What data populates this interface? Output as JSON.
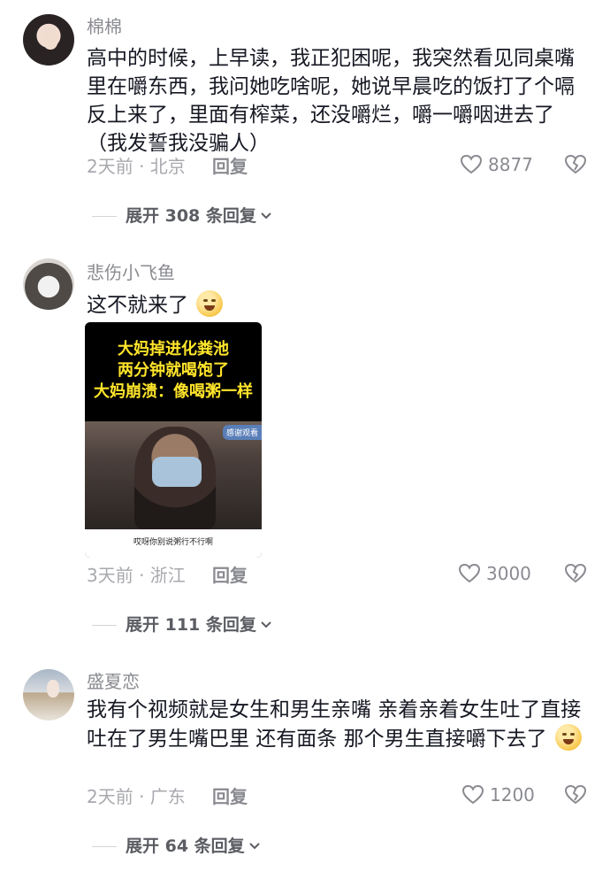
{
  "comments": [
    {
      "username": "棉棉",
      "text": "高中的时候，上早读，我正犯困呢，我突然看见同桌嘴里在嚼东西，我问她吃啥呢，她说早晨吃的饭打了个嗝反上来了，里面有榨菜，还没嚼烂，嚼一嚼咽进去了（我发誓我没骗人）",
      "meta": "2天前 · 北京",
      "reply_label": "回复",
      "likes": "8877",
      "expand_label": "展开 308 条回复"
    },
    {
      "username": "悲伤小飞鱼",
      "text": "这不就来了",
      "video": {
        "title_lines": [
          "大妈掉进化粪池",
          "两分钟就喝饱了",
          "大妈崩溃：像喝粥一样"
        ],
        "badge": "感谢观看",
        "caption": "哎呀你别说粥行不行啊"
      },
      "meta": "3天前 · 浙江",
      "reply_label": "回复",
      "likes": "3000",
      "expand_label": "展开 111 条回复"
    },
    {
      "username": "盛夏恋",
      "text": "我有个视频就是女生和男生亲嘴 亲着亲着女生吐了直接吐在了男生嘴巴里 还有面条 那个男生直接嚼下去了",
      "meta": "2天前 · 广东",
      "reply_label": "回复",
      "likes": "1200",
      "expand_label": "展开 64 条回复"
    }
  ],
  "icons": {
    "like": "heart-outline-icon",
    "dislike": "broken-heart-icon",
    "expand": "chevron-down-icon"
  },
  "colors": {
    "text": "#161823",
    "secondary": "#8a8b91",
    "meta": "#a8a9ae",
    "video_title": "#ffe52b"
  }
}
